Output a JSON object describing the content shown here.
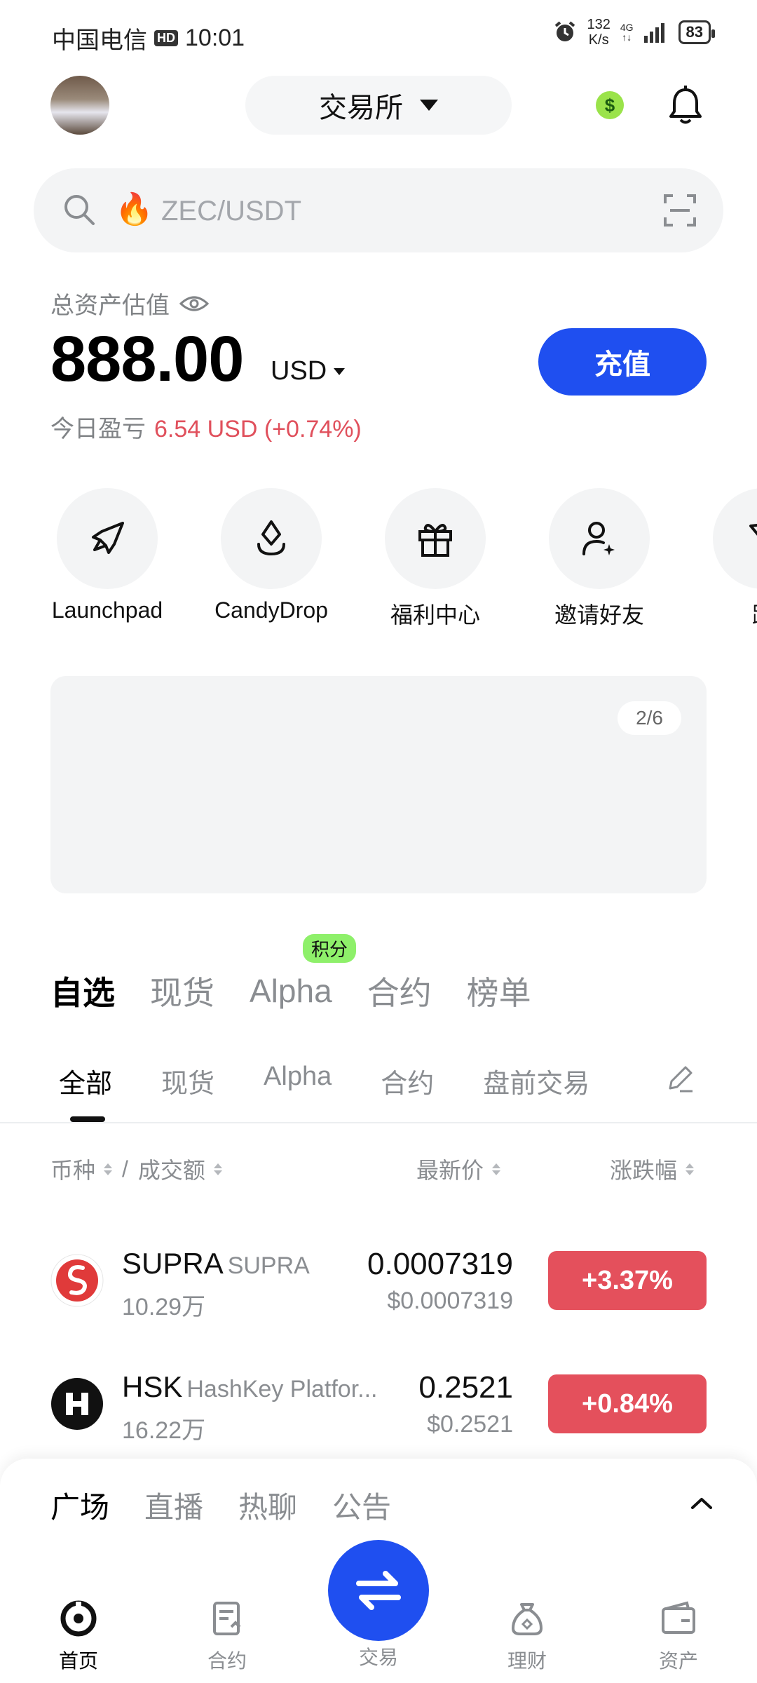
{
  "status_bar": {
    "carrier": "中国电信",
    "hd": "HD",
    "time": "10:01",
    "speed_value": "132",
    "speed_unit": "K/s",
    "network": "4G",
    "battery": "83"
  },
  "header": {
    "exchange_label": "交易所",
    "coin_symbol": "$"
  },
  "search": {
    "placeholder": "ZEC/USDT"
  },
  "assets": {
    "label": "总资产估值",
    "value": "888.00",
    "currency": "USD",
    "deposit_label": "充值",
    "pnl_label": "今日盈亏",
    "pnl_value": "6.54 USD (+0.74%)"
  },
  "quick_actions": [
    {
      "label": "Launchpad",
      "icon": "rocket-icon"
    },
    {
      "label": "CandyDrop",
      "icon": "candy-drop-icon"
    },
    {
      "label": "福利中心",
      "icon": "gift-icon"
    },
    {
      "label": "邀请好友",
      "icon": "invite-user-icon"
    },
    {
      "label": "跟",
      "icon": "copy-trade-icon"
    }
  ],
  "banner": {
    "pager": "2/6"
  },
  "main_tabs": [
    {
      "label": "自选",
      "active": true
    },
    {
      "label": "现货"
    },
    {
      "label": "Alpha",
      "badge": "积分"
    },
    {
      "label": "合约"
    },
    {
      "label": "榜单"
    }
  ],
  "sub_tabs": [
    {
      "label": "全部",
      "active": true
    },
    {
      "label": "现货"
    },
    {
      "label": "Alpha"
    },
    {
      "label": "合约"
    },
    {
      "label": "盘前交易"
    }
  ],
  "columns": {
    "coin": "币种",
    "sep": "/",
    "volume": "成交额",
    "price": "最新价",
    "change": "涨跌幅"
  },
  "rows": [
    {
      "symbol": "SUPRA",
      "name": "SUPRA",
      "volume": "10.29万",
      "price": "0.0007319",
      "usd": "$0.0007319",
      "change": "+3.37%"
    },
    {
      "symbol": "HSK",
      "name": "HashKey Platfor...",
      "volume": "16.22万",
      "price": "0.2521",
      "usd": "$0.2521",
      "change": "+0.84%"
    }
  ],
  "community_tabs": [
    {
      "label": "广场",
      "active": true
    },
    {
      "label": "直播"
    },
    {
      "label": "热聊"
    },
    {
      "label": "公告"
    }
  ],
  "bottom_nav": [
    {
      "label": "首页",
      "active": true
    },
    {
      "label": "合约"
    },
    {
      "label": "交易"
    },
    {
      "label": "理财"
    },
    {
      "label": "资产"
    }
  ],
  "colors": {
    "accent": "#1f4ff0",
    "up": "#e4505c",
    "badge": "#8ef06a"
  }
}
